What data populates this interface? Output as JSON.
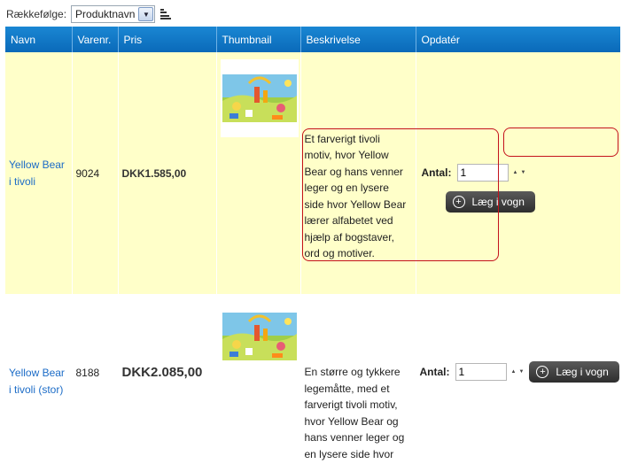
{
  "sort": {
    "label": "Rækkefølge:",
    "selected": "Produktnavn"
  },
  "table": {
    "headers": [
      "Navn",
      "Varenr.",
      "Pris",
      "Thumbnail",
      "Beskrivelse",
      "Opdatér"
    ],
    "rows": [
      {
        "name": "Yellow Bear i tivoli",
        "sku": "9024",
        "price": "DKK1.585,00",
        "description": "Et farverigt tivoli motiv, hvor Yellow Bear og hans venner leger og en lysere side hvor Yellow Bear lærer alfabetet ved hjælp af bogstaver, ord og motiver.",
        "qty_label": "Antal:",
        "qty": "1",
        "cart_label": "Læg i vogn"
      },
      {
        "name": "Yellow Bear i tivoli (stor)",
        "sku": "8188",
        "price": "DKK2.085,00",
        "description": "En større og tykkere legemåtte, med et farverigt tivoli motiv, hvor Yellow Bear og hans venner leger og en lysere side hvor",
        "qty_label": "Antal:",
        "qty": "1",
        "cart_label": "Læg i vogn"
      }
    ]
  }
}
